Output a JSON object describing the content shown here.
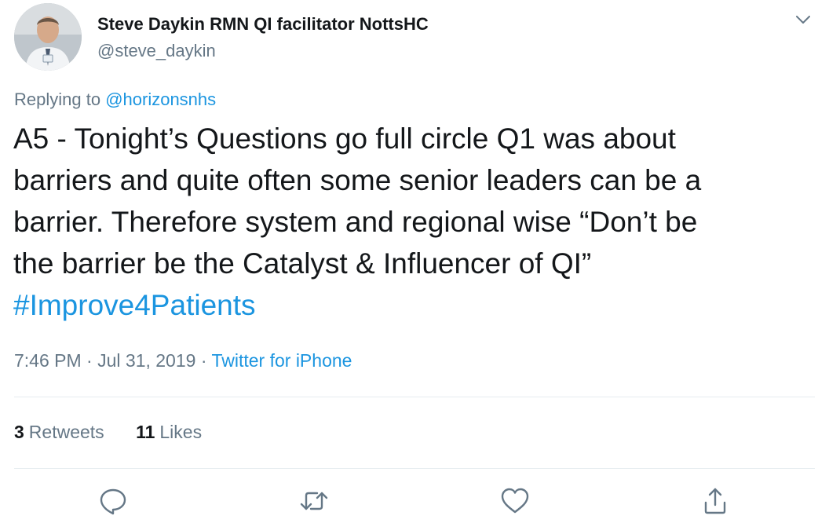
{
  "tweet": {
    "author": {
      "display_name": "Steve Daykin RMN QI facilitator NottsHC",
      "handle": "@steve_daykin"
    },
    "replying_prefix": "Replying to ",
    "replying_to": "@horizonsnhs",
    "text_lines": [
      "A5 - Tonight’s Questions go full circle Q1 was about",
      "barriers and quite often some senior leaders can be a",
      "barrier. Therefore system and regional wise “Don’t be",
      "the barrier be the Catalyst & Influencer of QI”"
    ],
    "hashtag": "#Improve4Patients",
    "time": "7:46 PM",
    "separator": " · ",
    "date": "Jul 31, 2019",
    "source": "Twitter for iPhone",
    "retweets_count": "3",
    "retweets_label": "Retweets",
    "likes_count": "11",
    "likes_label": "Likes"
  },
  "icons": {
    "menu": "chevron-down-icon",
    "reply": "reply-icon",
    "retweet": "retweet-icon",
    "like": "heart-icon",
    "share": "share-icon"
  },
  "colors": {
    "text": "#14171a",
    "secondary": "#657786",
    "link": "#1b95e0",
    "divider": "#e6ecf0"
  }
}
